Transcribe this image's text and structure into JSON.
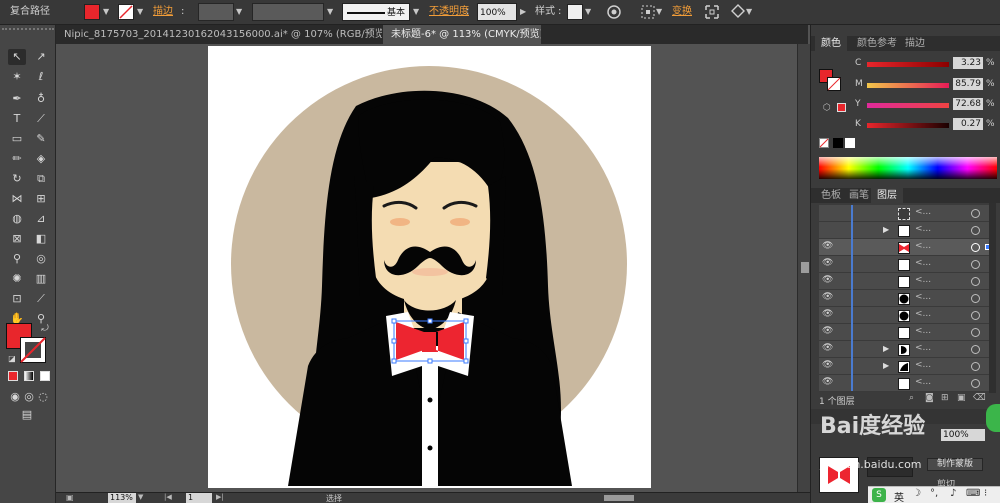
{
  "control_bar": {
    "object_type": "复合路径",
    "stroke_label": "描边",
    "stroke_stepper": ":",
    "brush_style": "基本",
    "opacity_label": "不透明度",
    "opacity_value": "100%",
    "style_label": "样式",
    "style_colon": ":",
    "transform_label": "变换",
    "fill_color": "#e8262c"
  },
  "tabs": [
    {
      "label": "Nipic_8175703_20141230162043156000.ai* @ 107% (RGB/预览)",
      "active": false
    },
    {
      "label": "未标题-6* @ 113% (CMYK/预览)",
      "active": true
    }
  ],
  "tab_close": "×",
  "color_panel": {
    "tabs": [
      "颜色",
      "颜色参考",
      "描边"
    ],
    "channels": [
      {
        "name": "C",
        "value": "3.23",
        "unit": "%"
      },
      {
        "name": "M",
        "value": "85.79",
        "unit": "%"
      },
      {
        "name": "Y",
        "value": "72.68",
        "unit": "%"
      },
      {
        "name": "K",
        "value": "0.27",
        "unit": "%"
      }
    ],
    "current_color": "#e8262c"
  },
  "layers_panel": {
    "tabs": [
      "色板",
      "画笔",
      "图层"
    ],
    "item_label": "<...",
    "count": "1 个图层",
    "rows": [
      {
        "eye": false,
        "has_arrow": false,
        "thumb": "dashed"
      },
      {
        "eye": false,
        "has_arrow": true,
        "thumb": "white"
      },
      {
        "eye": true,
        "has_arrow": false,
        "thumb": "bowtie",
        "selected": true
      },
      {
        "eye": true,
        "has_arrow": false,
        "thumb": "white"
      },
      {
        "eye": true,
        "has_arrow": false,
        "thumb": "white"
      },
      {
        "eye": true,
        "has_arrow": false,
        "thumb": "black-circle"
      },
      {
        "eye": true,
        "has_arrow": false,
        "thumb": "black-circle"
      },
      {
        "eye": true,
        "has_arrow": false,
        "thumb": "white"
      },
      {
        "eye": true,
        "has_arrow": true,
        "thumb": "half-moon"
      },
      {
        "eye": true,
        "has_arrow": true,
        "thumb": "quarter"
      },
      {
        "eye": true,
        "has_arrow": false,
        "thumb": "white"
      }
    ]
  },
  "transparency_panel": {
    "opacity_value": "100%",
    "make_mask_label": "制作蒙版",
    "clip_label": "剪切"
  },
  "status_bar": {
    "zoom": "113%",
    "page": "1",
    "mode": "选择"
  },
  "watermark": {
    "brand": "Bai度经验",
    "site": "jingyan.baidu.com",
    "ime": "英"
  },
  "artwork": {
    "bg_circle": "#c9b89f",
    "hair": "#050505",
    "skin": "#f4dcb2",
    "neck": "#f4dcb2",
    "shirt": "#ffffff",
    "bowtie": "#ed2530",
    "blush": "#f1b584",
    "lips": "#f3c3a0"
  }
}
